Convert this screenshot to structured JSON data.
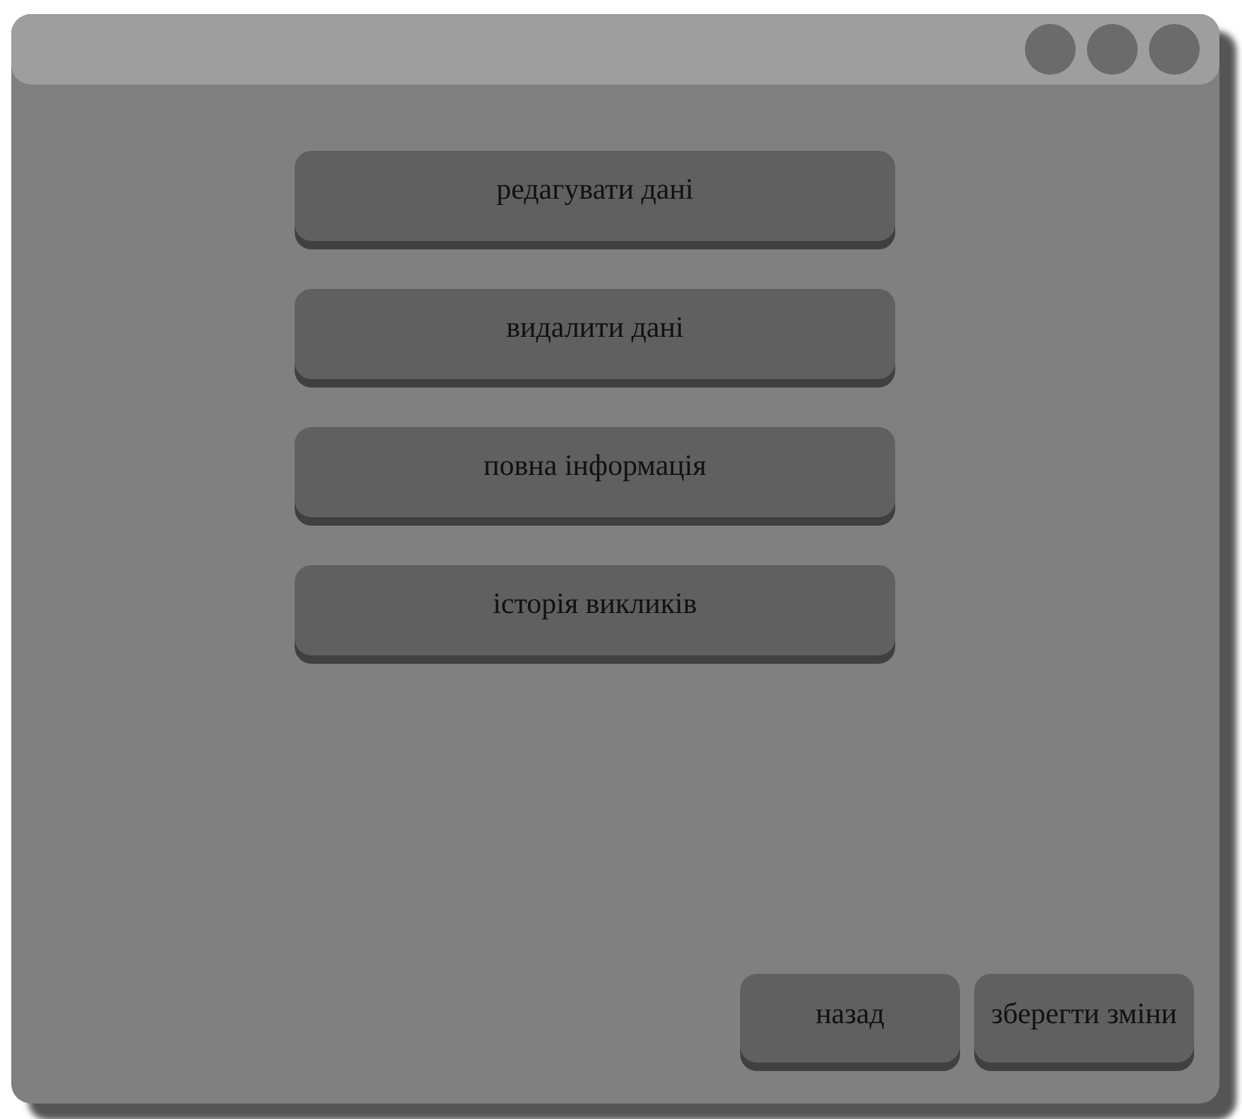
{
  "menu_buttons": [
    {
      "label": "редагувати дані"
    },
    {
      "label": "видалити дані"
    },
    {
      "label": "повна інформація"
    },
    {
      "label": "історія викликів"
    }
  ],
  "footer_buttons": [
    {
      "label": "назад"
    },
    {
      "label": "зберегти зміни"
    }
  ]
}
